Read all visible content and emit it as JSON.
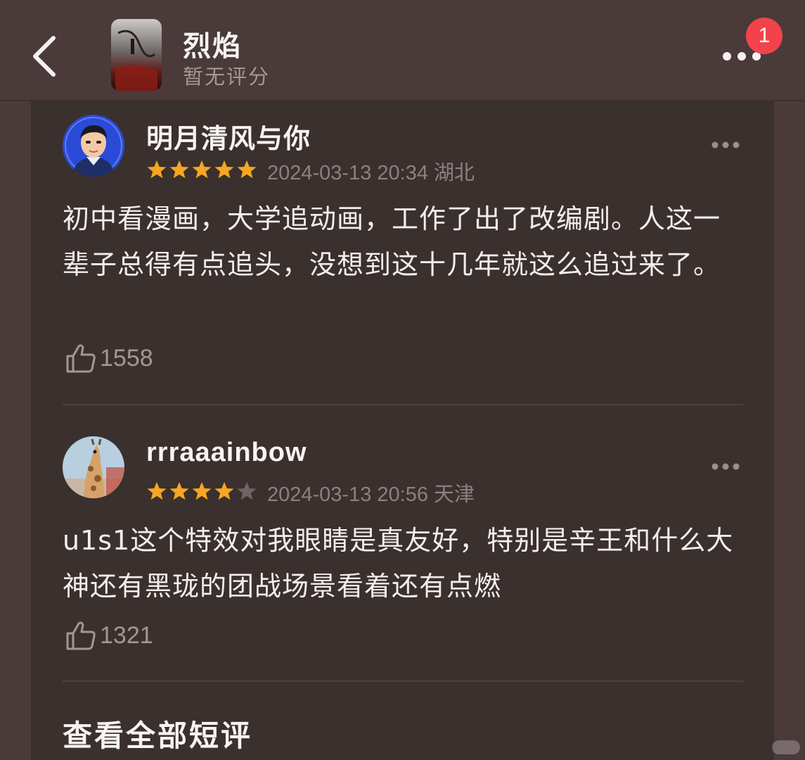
{
  "header": {
    "title": "烈焰",
    "subtitle": "暂无评分",
    "notification_count": "1"
  },
  "reviews": [
    {
      "username": "明月清风与你",
      "rating": 5,
      "meta": "2024-03-13 20:34 湖北",
      "text": "初中看漫画，大学追动画，工作了出了改编剧。人这一辈子总得有点追头，没想到这十几年就这么追过来了。",
      "likes": "1558"
    },
    {
      "username": "rrraaainbow",
      "rating": 4,
      "meta": "2024-03-13 20:56 天津",
      "text": "u1s1这个特效对我眼睛是真友好，特别是辛王和什么大神还有黑珑的团战场景看着还有点燃",
      "likes": "1321"
    }
  ],
  "see_all_label": "查看全部短评",
  "colors": {
    "background": "#4a3a3a",
    "panel": "#3a302e",
    "star_active": "#f5a623",
    "star_inactive": "#6e6463",
    "badge": "#f2434b"
  },
  "icons": {
    "back": "chevron-left-icon",
    "more": "more-horizontal-icon",
    "like": "thumbs-up-icon",
    "star": "star-icon"
  }
}
